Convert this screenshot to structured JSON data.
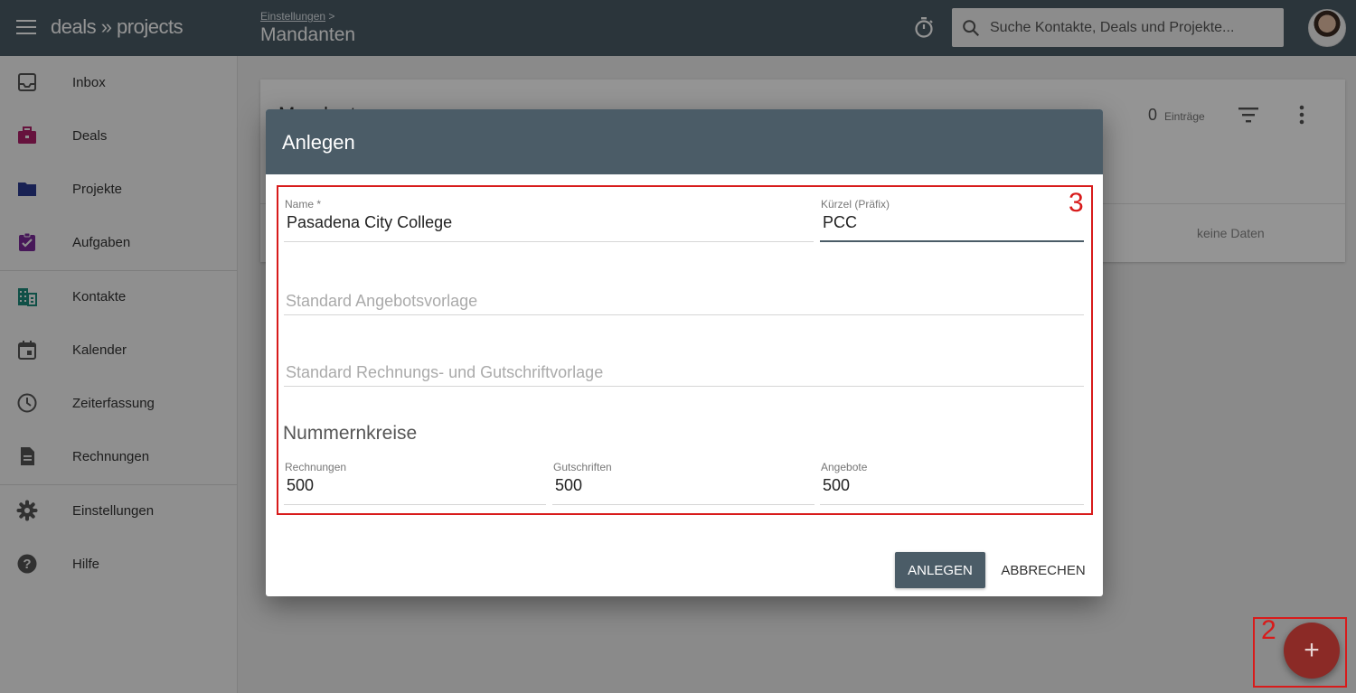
{
  "app": {
    "logo": "deals » projects"
  },
  "header": {
    "breadcrumb": "Einstellungen",
    "breadcrumb_sep": ">",
    "title": "Mandanten",
    "search": {
      "placeholder": "Suche Kontakte, Deals und Projekte..."
    }
  },
  "sidebar": {
    "items": [
      {
        "label": "Inbox",
        "icon": "inbox-icon",
        "color": "#555555"
      },
      {
        "label": "Deals",
        "icon": "briefcase-icon",
        "color": "#b0206a"
      },
      {
        "label": "Projekte",
        "icon": "folder-icon",
        "color": "#2a3a8f"
      },
      {
        "label": "Aufgaben",
        "icon": "clipboard-check-icon",
        "color": "#7b2a9a"
      },
      {
        "label": "Kontakte",
        "icon": "building-icon",
        "color": "#1d8a7a"
      },
      {
        "label": "Kalender",
        "icon": "calendar-icon",
        "color": "#555555"
      },
      {
        "label": "Zeiterfassung",
        "icon": "clock-icon",
        "color": "#555555"
      },
      {
        "label": "Rechnungen",
        "icon": "document-icon",
        "color": "#555555"
      },
      {
        "label": "Einstellungen",
        "icon": "gear-icon",
        "color": "#555555"
      },
      {
        "label": "Hilfe",
        "icon": "help-icon",
        "color": "#555555"
      }
    ]
  },
  "content": {
    "card_title": "Mandanten",
    "count": "0",
    "count_label": "Einträge",
    "empty": "keine Daten"
  },
  "dialog": {
    "title": "Anlegen",
    "name": {
      "label": "Name *",
      "value": "Pasadena City College"
    },
    "prefix": {
      "label": "Kürzel (Präfix)",
      "value": "PCC"
    },
    "offer_template": {
      "placeholder": "Standard Angebotsvorlage"
    },
    "invoice_template": {
      "placeholder": "Standard Rechnungs- und Gutschriftvorlage"
    },
    "section_title": "Nummernkreise",
    "invoices": {
      "label": "Rechnungen",
      "value": "500"
    },
    "credits": {
      "label": "Gutschriften",
      "value": "500"
    },
    "offers": {
      "label": "Angebote",
      "value": "500"
    },
    "create_label": "ANLEGEN",
    "cancel_label": "ABBRECHEN"
  },
  "annotations": {
    "form_marker": "3",
    "fab_marker": "2"
  },
  "fab": {
    "symbol": "+"
  },
  "colors": {
    "header_bg": "#4b5c67",
    "annotation_red": "#d81b1b",
    "fab_bg": "#8b2a26"
  }
}
